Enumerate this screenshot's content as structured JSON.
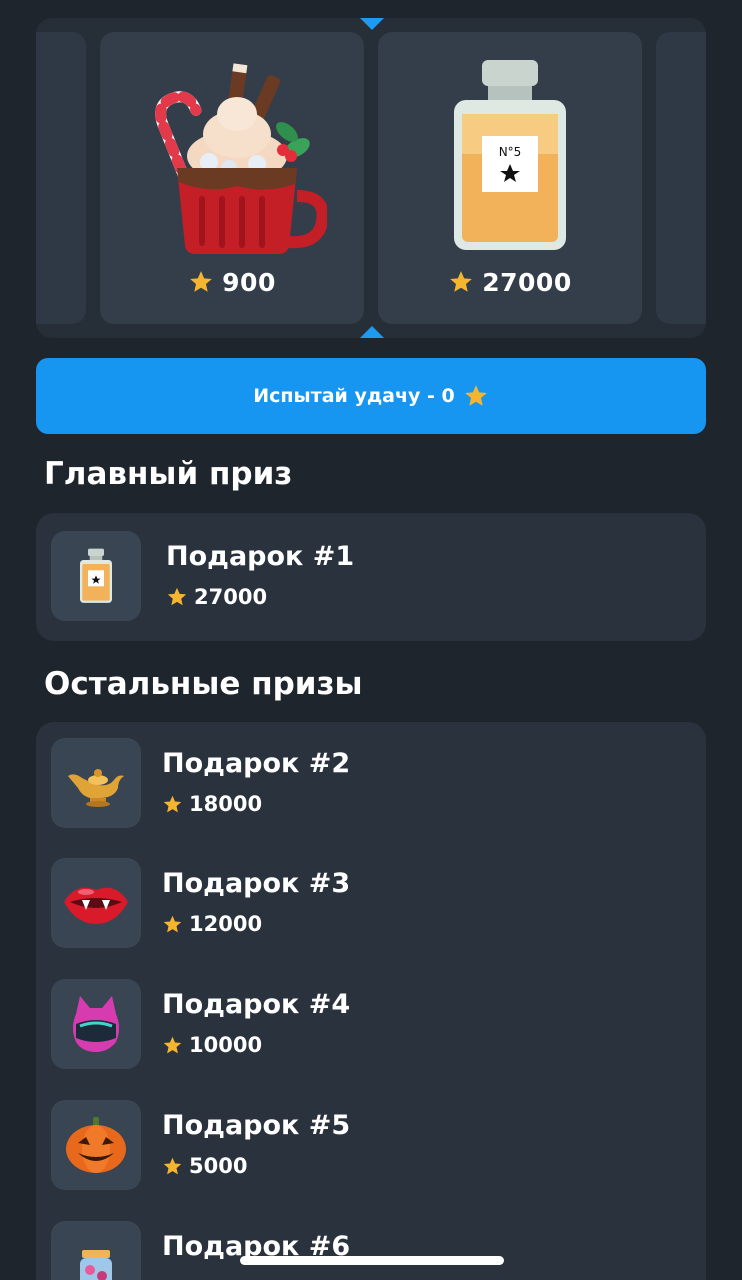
{
  "carousel": {
    "items": [
      {
        "icon": "hot-cocoa-icon",
        "price": "900"
      },
      {
        "icon": "perfume-icon",
        "price": "27000",
        "label": "N°5"
      }
    ]
  },
  "luck_button": {
    "label": "Испытай удачу - 0"
  },
  "main_prize": {
    "title": "Главный приз",
    "item": {
      "icon": "perfume-icon",
      "name": "Подарок #1",
      "price": "27000"
    }
  },
  "other_prizes": {
    "title": "Остальные призы",
    "items": [
      {
        "icon": "magic-lamp-icon",
        "name": "Подарок #2",
        "price": "18000"
      },
      {
        "icon": "vampire-lips-icon",
        "name": "Подарок #3",
        "price": "12000"
      },
      {
        "icon": "cat-helmet-icon",
        "name": "Подарок #4",
        "price": "10000"
      },
      {
        "icon": "pumpkin-icon",
        "name": "Подарок #5",
        "price": "5000"
      },
      {
        "icon": "candy-jar-icon",
        "name": "Подарок #6"
      }
    ]
  },
  "colors": {
    "accent": "#1696f0",
    "background": "#1e252d",
    "panel": "#2a323d",
    "star": "#f5b52e"
  }
}
